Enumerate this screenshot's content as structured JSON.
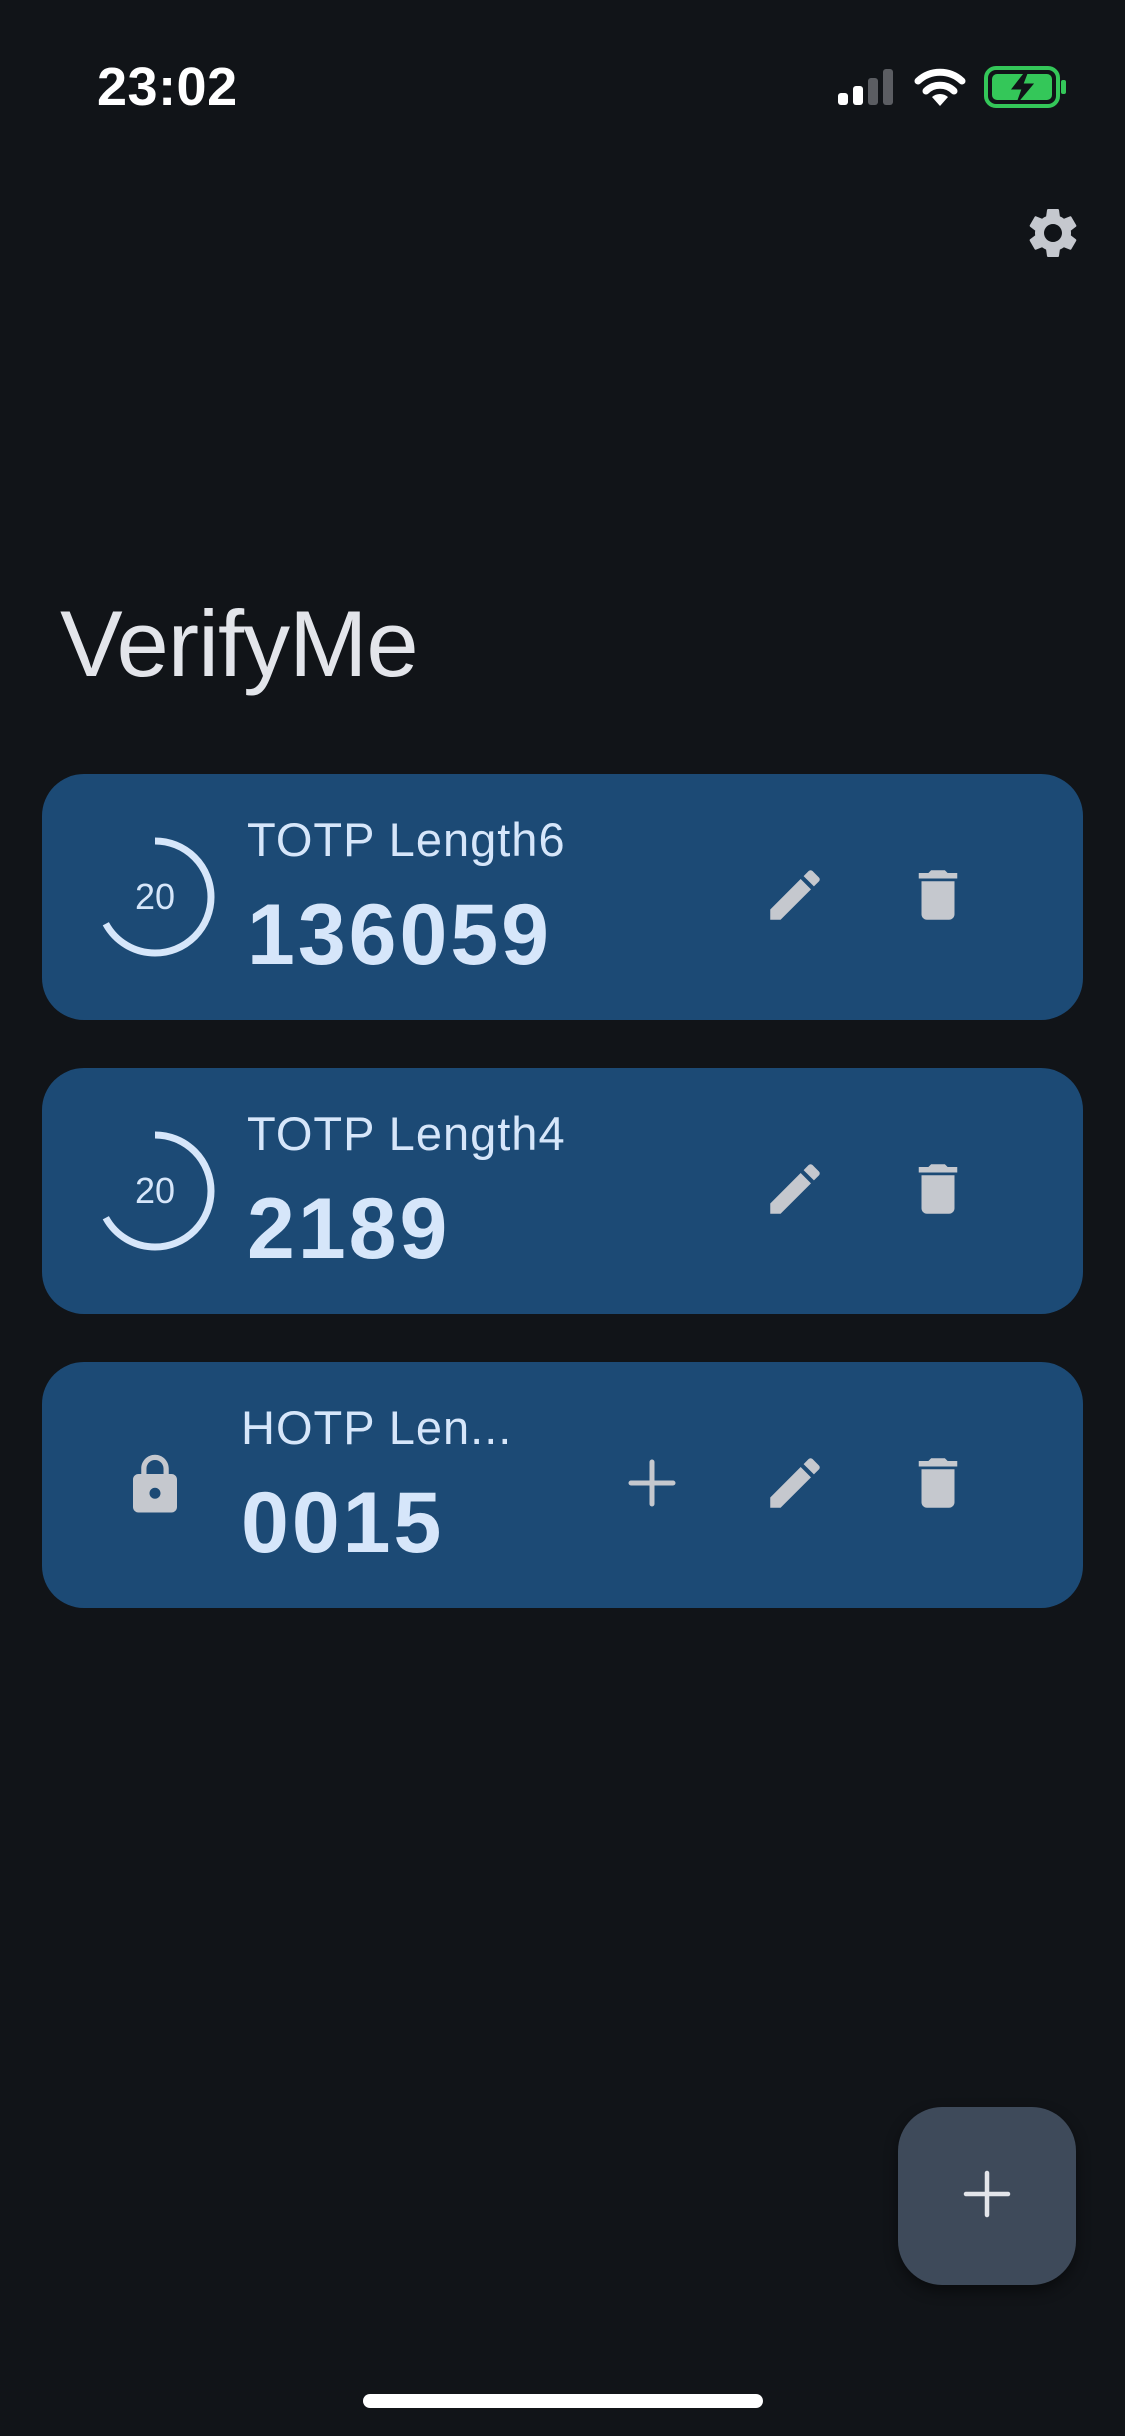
{
  "status_bar": {
    "time": "23:02",
    "icons": [
      "cellular-signal-icon",
      "wifi-icon",
      "battery-charging-icon"
    ]
  },
  "header": {
    "title": "VerifyMe",
    "settings_icon": "gear-icon"
  },
  "accounts": [
    {
      "type": "TOTP",
      "name": "TOTP Length6",
      "code": "136059",
      "seconds_remaining": "20",
      "period_fraction_remaining": 0.67,
      "leading_icon": "timer-ring-icon"
    },
    {
      "type": "TOTP",
      "name": "TOTP Length4",
      "code": "2189",
      "seconds_remaining": "20",
      "period_fraction_remaining": 0.67,
      "leading_icon": "timer-ring-icon"
    },
    {
      "type": "HOTP",
      "name": "HOTP Len...",
      "code": "0015",
      "leading_icon": "lock-icon",
      "has_increment": true
    }
  ],
  "actions": {
    "edit_icon": "pencil-icon",
    "delete_icon": "trash-icon",
    "increment_icon": "plus-icon",
    "add_icon": "plus-icon"
  },
  "colors": {
    "background": "#111418",
    "card": "#1c4a75",
    "card_text": "#d6e6fa",
    "icon": "#c5c8ce",
    "fab": "#3e4a5a",
    "battery": "#34c759"
  }
}
